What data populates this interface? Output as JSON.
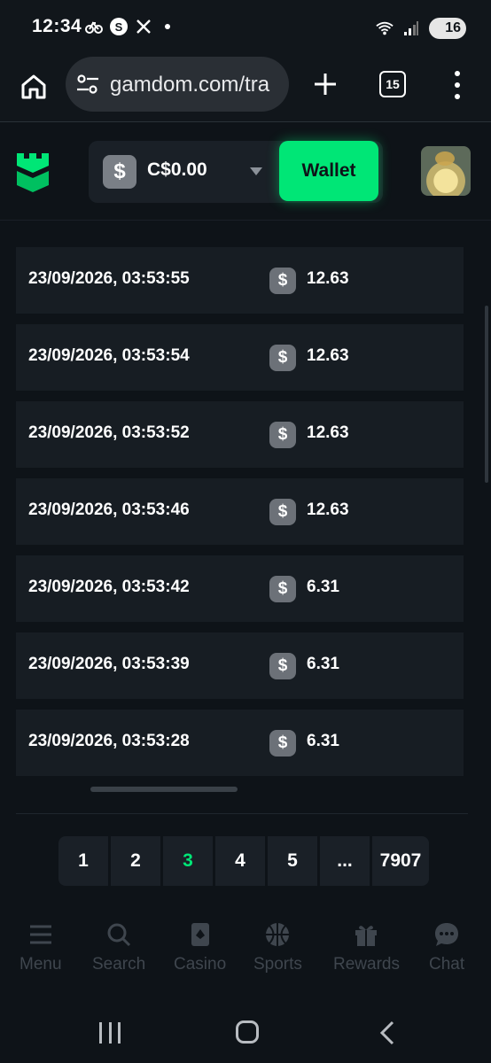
{
  "status_bar": {
    "time": "12:34",
    "battery": "16",
    "icons": [
      "notification-bike-icon",
      "s-app-icon",
      "x-app-icon",
      "dot-icon",
      "wifi-icon",
      "signal-icon",
      "battery-icon"
    ]
  },
  "browser": {
    "url": "gamdom.com/tra",
    "tab_count": "15"
  },
  "header": {
    "currency_symbol": "$",
    "balance": "C$0.00",
    "wallet_label": "Wallet",
    "accent_color": "#00e676"
  },
  "transactions": [
    {
      "date": "23/09/2026, 03:53:55",
      "coin": "$",
      "amount": "12.63"
    },
    {
      "date": "23/09/2026, 03:53:54",
      "coin": "$",
      "amount": "12.63"
    },
    {
      "date": "23/09/2026, 03:53:52",
      "coin": "$",
      "amount": "12.63"
    },
    {
      "date": "23/09/2026, 03:53:46",
      "coin": "$",
      "amount": "12.63"
    },
    {
      "date": "23/09/2026, 03:53:42",
      "coin": "$",
      "amount": "6.31"
    },
    {
      "date": "23/09/2026, 03:53:39",
      "coin": "$",
      "amount": "6.31"
    },
    {
      "date": "23/09/2026, 03:53:28",
      "coin": "$",
      "amount": "6.31"
    }
  ],
  "pagination": {
    "pages": [
      "1",
      "2",
      "3",
      "4",
      "5",
      "...",
      "7907"
    ],
    "active": "3"
  },
  "bottom_nav": [
    {
      "label": "Menu",
      "icon": "menu-icon"
    },
    {
      "label": "Search",
      "icon": "search-icon"
    },
    {
      "label": "Casino",
      "icon": "casino-card-icon"
    },
    {
      "label": "Sports",
      "icon": "basketball-icon"
    },
    {
      "label": "Rewards",
      "icon": "gift-icon"
    },
    {
      "label": "Chat",
      "icon": "chat-icon"
    }
  ]
}
